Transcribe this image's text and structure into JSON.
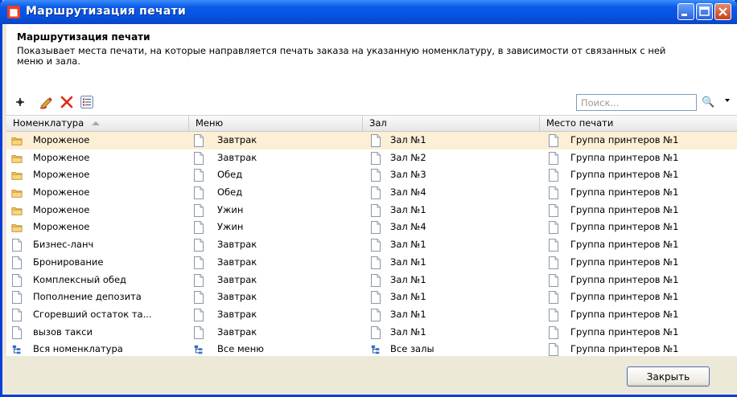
{
  "window": {
    "title": "Маршрутизация печати",
    "accent": "#0a5ae8"
  },
  "header": {
    "title": "Маршрутизация печати",
    "description": "Показывает места печати, на которые направляется печать заказа на указанную номенклатуру, в зависимости от связанных с ней меню и зала."
  },
  "toolbar": {
    "icons": [
      "add-icon",
      "edit-icon",
      "delete-icon",
      "list-icon"
    ],
    "search_placeholder": "Поиск...",
    "search_value": ""
  },
  "table": {
    "columns": [
      "Номенклатура",
      "Меню",
      "Зал",
      "Место печати"
    ],
    "sort_column": "Номенклатура",
    "sort_direction": "asc",
    "rows": [
      {
        "nom": "Мороженое",
        "nom_icon": "folder",
        "menu": "Завтрак",
        "menu_icon": "doc",
        "hall": "Зал №1",
        "hall_icon": "doc",
        "place": "Группа принтеров №1",
        "place_icon": "doc",
        "selected": true
      },
      {
        "nom": "Мороженое",
        "nom_icon": "folder",
        "menu": "Завтрак",
        "menu_icon": "doc",
        "hall": "Зал №2",
        "hall_icon": "doc",
        "place": "Группа принтеров №1",
        "place_icon": "doc"
      },
      {
        "nom": "Мороженое",
        "nom_icon": "folder",
        "menu": "Обед",
        "menu_icon": "doc",
        "hall": "Зал №3",
        "hall_icon": "doc",
        "place": "Группа принтеров №1",
        "place_icon": "doc"
      },
      {
        "nom": "Мороженое",
        "nom_icon": "folder",
        "menu": "Обед",
        "menu_icon": "doc",
        "hall": "Зал №4",
        "hall_icon": "doc",
        "place": "Группа принтеров №1",
        "place_icon": "doc"
      },
      {
        "nom": "Мороженое",
        "nom_icon": "folder",
        "menu": "Ужин",
        "menu_icon": "doc",
        "hall": "Зал №1",
        "hall_icon": "doc",
        "place": "Группа принтеров №1",
        "place_icon": "doc"
      },
      {
        "nom": "Мороженое",
        "nom_icon": "folder",
        "menu": "Ужин",
        "menu_icon": "doc",
        "hall": "Зал №4",
        "hall_icon": "doc",
        "place": "Группа принтеров №1",
        "place_icon": "doc"
      },
      {
        "nom": "Бизнес-ланч",
        "nom_icon": "doc",
        "menu": "Завтрак",
        "menu_icon": "doc",
        "hall": "Зал №1",
        "hall_icon": "doc",
        "place": "Группа принтеров №1",
        "place_icon": "doc"
      },
      {
        "nom": "Бронирование",
        "nom_icon": "doc",
        "menu": "Завтрак",
        "menu_icon": "doc",
        "hall": "Зал №1",
        "hall_icon": "doc",
        "place": "Группа принтеров №1",
        "place_icon": "doc"
      },
      {
        "nom": "Комплексный обед",
        "nom_icon": "doc",
        "menu": "Завтрак",
        "menu_icon": "doc",
        "hall": "Зал №1",
        "hall_icon": "doc",
        "place": "Группа принтеров №1",
        "place_icon": "doc"
      },
      {
        "nom": "Пополнение депозита",
        "nom_icon": "doc",
        "menu": "Завтрак",
        "menu_icon": "doc",
        "hall": "Зал №1",
        "hall_icon": "doc",
        "place": "Группа принтеров №1",
        "place_icon": "doc"
      },
      {
        "nom": "Сгоревший остаток та...",
        "nom_icon": "doc",
        "menu": "Завтрак",
        "menu_icon": "doc",
        "hall": "Зал №1",
        "hall_icon": "doc",
        "place": "Группа принтеров №1",
        "place_icon": "doc"
      },
      {
        "nom": "вызов такси",
        "nom_icon": "doc",
        "menu": "Завтрак",
        "menu_icon": "doc",
        "hall": "Зал №1",
        "hall_icon": "doc",
        "place": "Группа принтеров №1",
        "place_icon": "doc"
      },
      {
        "nom": "Вся номенклатура",
        "nom_icon": "tree",
        "menu": "Все меню",
        "menu_icon": "tree",
        "hall": "Все залы",
        "hall_icon": "tree",
        "place": "Группа принтеров №1",
        "place_icon": "doc"
      }
    ]
  },
  "footer": {
    "close_label": "Закрыть"
  }
}
